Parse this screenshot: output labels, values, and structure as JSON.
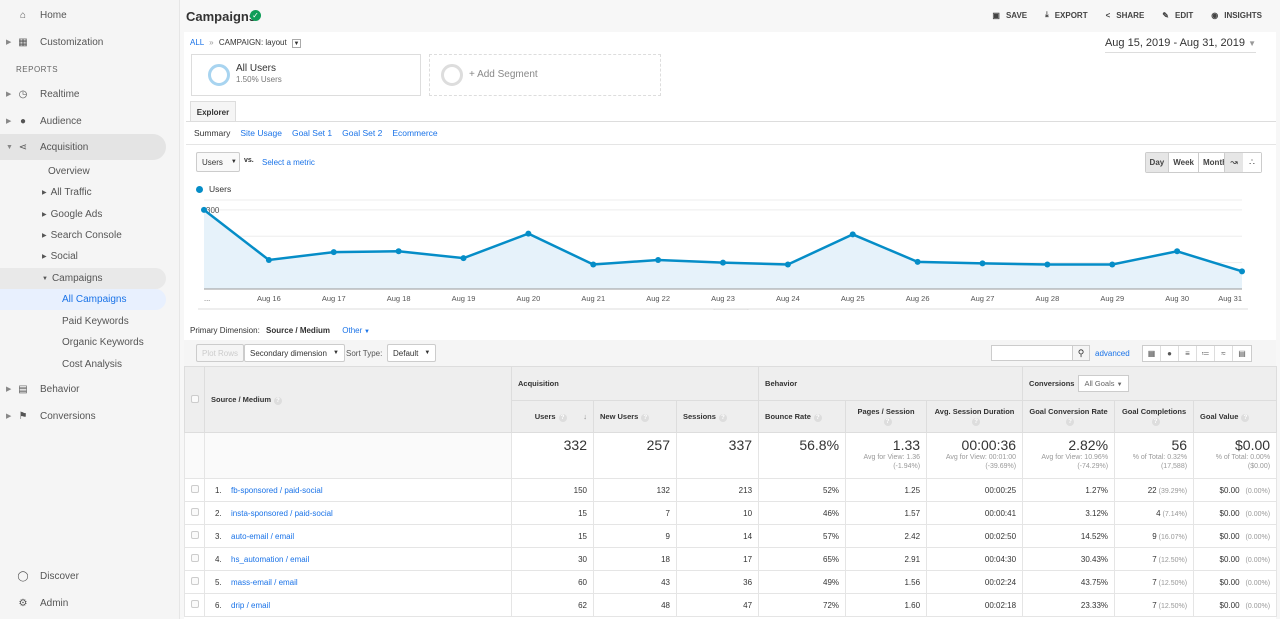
{
  "sidebar": {
    "home": "Home",
    "customization": "Customization",
    "reports_label": "REPORTS",
    "realtime": "Realtime",
    "audience": "Audience",
    "acquisition": "Acquisition",
    "acq_items": [
      "Overview",
      "All Traffic",
      "Google Ads",
      "Search Console",
      "Social",
      "Campaigns"
    ],
    "campaign_items": [
      "All Campaigns",
      "Paid Keywords",
      "Organic Keywords",
      "Cost Analysis"
    ],
    "behavior": "Behavior",
    "conversions": "Conversions",
    "discover": "Discover",
    "admin": "Admin"
  },
  "header": {
    "title": "Campaigns",
    "actions": [
      "SAVE",
      "EXPORT",
      "SHARE",
      "EDIT",
      "INSIGHTS"
    ],
    "breadcrumb_all": "ALL",
    "breadcrumb_current": "CAMPAIGN: layout",
    "date_range": "Aug 15, 2019 - Aug 31, 2019"
  },
  "segments": {
    "active_name": "All Users",
    "active_sub": "1.50% Users",
    "add_label": "+ Add Segment"
  },
  "explorer": {
    "tab": "Explorer",
    "subtabs": [
      "Summary",
      "Site Usage",
      "Goal Set 1",
      "Goal Set 2",
      "Ecommerce"
    ],
    "metric": "Users",
    "vs": "vs.",
    "select_metric": "Select a metric",
    "periods": [
      "Day",
      "Week",
      "Month"
    ],
    "active_period": "Day"
  },
  "chart_data": {
    "type": "area",
    "legend": [
      "Users"
    ],
    "color": "#058dc7",
    "x": [
      "...",
      "Aug 16",
      "Aug 17",
      "Aug 18",
      "Aug 19",
      "Aug 20",
      "Aug 21",
      "Aug 22",
      "Aug 23",
      "Aug 24",
      "Aug 25",
      "Aug 26",
      "Aug 27",
      "Aug 28",
      "Aug 29",
      "Aug 30",
      "Aug 31"
    ],
    "series": [
      {
        "name": "Users",
        "values": [
          300,
          110,
          140,
          143,
          117,
          210,
          93,
          110,
          100,
          93,
          207,
          103,
          97,
          93,
          93,
          143,
          67
        ]
      }
    ],
    "yticks": [
      100,
      200,
      300
    ],
    "ylim": [
      0,
      330
    ],
    "grid": true
  },
  "table": {
    "primary_dimension_label": "Primary Dimension:",
    "primary_dimension": "Source / Medium",
    "other": "Other",
    "plot_rows": "Plot Rows",
    "secondary_dimension": "Secondary dimension",
    "sort_type_label": "Sort Type:",
    "sort_type": "Default",
    "advanced": "advanced",
    "groups": [
      "Acquisition",
      "Behavior",
      "Conversions"
    ],
    "goal_select": "All Goals",
    "dim_header": "Source / Medium",
    "columns": [
      "Users",
      "New Users",
      "Sessions",
      "Bounce Rate",
      "Pages / Session",
      "Avg. Session Duration",
      "Goal Conversion Rate",
      "Goal Completions",
      "Goal Value"
    ],
    "totals": {
      "users": "332",
      "new_users": "257",
      "sessions": "337",
      "bounce": "56.8%",
      "pages": "1.33",
      "pages_sub": "Avg for View: 1.36 (-1.94%)",
      "duration": "00:00:36",
      "duration_sub": "Avg for View: 00:01:00 (-39.69%)",
      "conv_rate": "2.82%",
      "conv_rate_sub": "Avg for View: 10.96% (-74.29%)",
      "completions": "56",
      "completions_sub": "% of Total: 0.32% (17,588)",
      "value": "$0.00",
      "value_sub": "% of Total: 0.00% ($0.00)"
    },
    "rows": [
      {
        "n": "1.",
        "source": "fb-sponsored / paid-social",
        "users": "150",
        "new_users": "132",
        "sessions": "213",
        "bounce": "52%",
        "pages": "1.25",
        "duration": "00:00:25",
        "conv": "1.27%",
        "comp": "22",
        "comp_pct": "(39.29%)",
        "value": "$0.00",
        "value_pct": "(0.00%)"
      },
      {
        "n": "2.",
        "source": "insta-sponsored / paid-social",
        "users": "15",
        "new_users": "7",
        "sessions": "10",
        "bounce": "46%",
        "pages": "1.57",
        "duration": "00:00:41",
        "conv": "3.12%",
        "comp": "4",
        "comp_pct": "(7.14%)",
        "value": "$0.00",
        "value_pct": "(0.00%)"
      },
      {
        "n": "3.",
        "source": "auto-email / email",
        "users": "15",
        "new_users": "9",
        "sessions": "14",
        "bounce": "57%",
        "pages": "2.42",
        "duration": "00:02:50",
        "conv": "14.52%",
        "comp": "9",
        "comp_pct": "(16.07%)",
        "value": "$0.00",
        "value_pct": "(0.00%)"
      },
      {
        "n": "4.",
        "source": "hs_automation / email",
        "users": "30",
        "new_users": "18",
        "sessions": "17",
        "bounce": "65%",
        "pages": "2.91",
        "duration": "00:04:30",
        "conv": "30.43%",
        "comp": "7",
        "comp_pct": "(12.50%)",
        "value": "$0.00",
        "value_pct": "(0.00%)"
      },
      {
        "n": "5.",
        "source": "mass-email / email",
        "users": "60",
        "new_users": "43",
        "sessions": "36",
        "bounce": "49%",
        "pages": "1.56",
        "duration": "00:02:24",
        "conv": "43.75%",
        "comp": "7",
        "comp_pct": "(12.50%)",
        "value": "$0.00",
        "value_pct": "(0.00%)"
      },
      {
        "n": "6.",
        "source": "drip / email",
        "users": "62",
        "new_users": "48",
        "sessions": "47",
        "bounce": "72%",
        "pages": "1.60",
        "duration": "00:02:18",
        "conv": "23.33%",
        "comp": "7",
        "comp_pct": "(12.50%)",
        "value": "$0.00",
        "value_pct": "(0.00%)"
      }
    ]
  }
}
